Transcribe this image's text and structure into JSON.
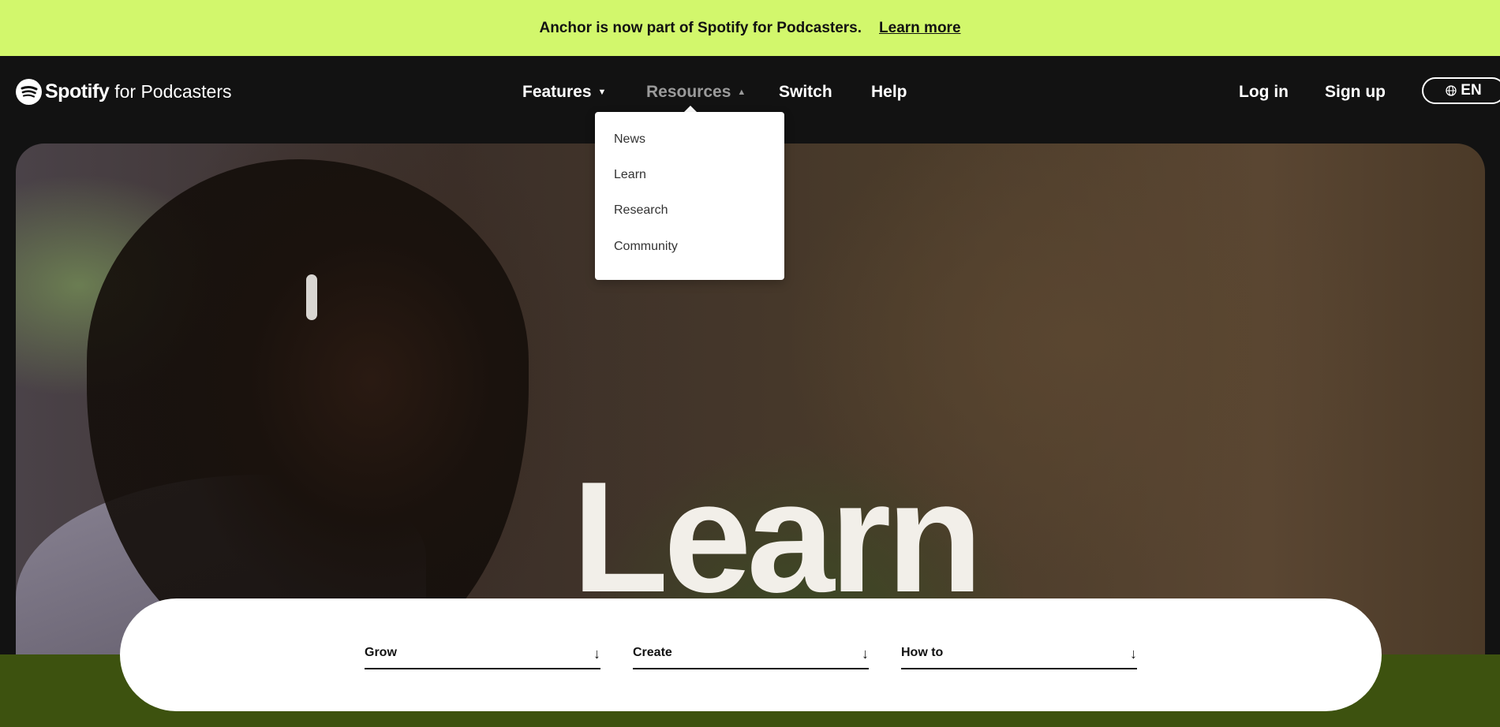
{
  "announcement": {
    "text": "Anchor is now part of Spotify for Podcasters.",
    "link": "Learn more"
  },
  "header": {
    "logo_brand": "Spotify",
    "logo_sub": "for Podcasters",
    "nav": [
      {
        "label": "Features",
        "caret": "▼"
      },
      {
        "label": "Resources",
        "caret": "▲"
      },
      {
        "label": "Switch"
      },
      {
        "label": "Help"
      }
    ],
    "login": "Log in",
    "signup": "Sign up",
    "language": "EN"
  },
  "resources_menu": {
    "items": [
      "News",
      "Learn",
      "Research",
      "Community"
    ]
  },
  "hero": {
    "title": "Learn"
  },
  "filters": [
    {
      "label": "Grow",
      "icon": "arrow-down-icon"
    },
    {
      "label": "Create",
      "icon": "arrow-down-icon"
    },
    {
      "label": "How to",
      "icon": "arrow-down-icon"
    }
  ],
  "colors": {
    "announce_bg": "#d2f76c",
    "header_bg": "#121212",
    "band_green": "#3d520f"
  }
}
